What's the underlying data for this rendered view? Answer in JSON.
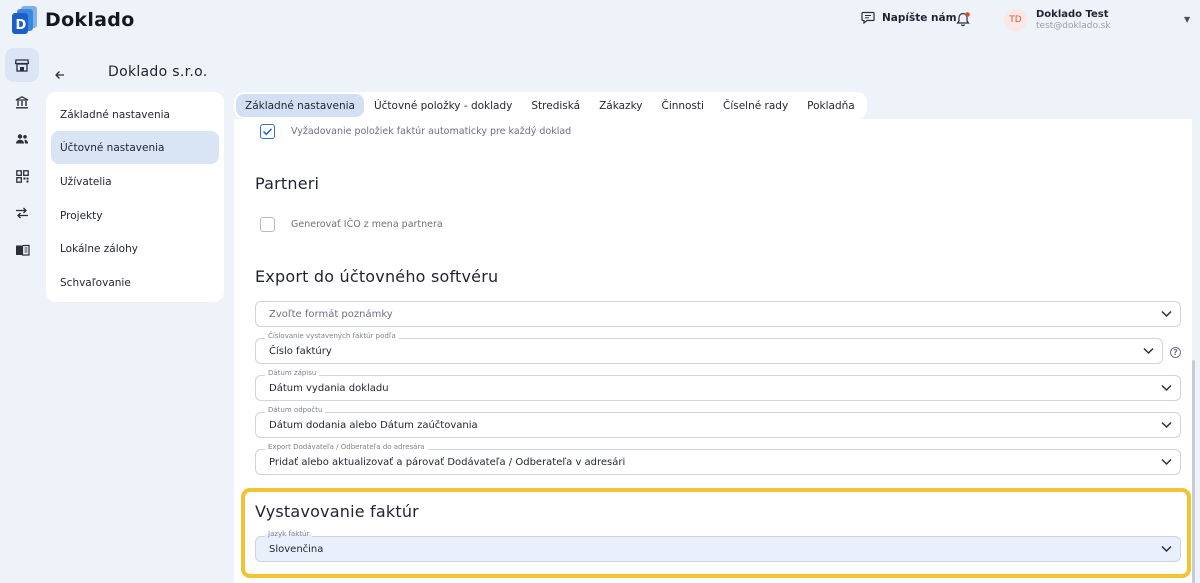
{
  "app": {
    "name": "Doklado"
  },
  "header": {
    "contact_label": "Napíšte nám",
    "avatar_initials": "TD",
    "user_name": "Doklado Test",
    "user_email": "test@doklado.sk"
  },
  "rail": {
    "icons": [
      "store-icon",
      "bank-icon",
      "people-icon",
      "qr-code-icon",
      "transfer-icon",
      "book-icon"
    ],
    "active_index": 0
  },
  "page": {
    "company_name": "Doklado s.r.o."
  },
  "sidebar": {
    "items": [
      {
        "label": "Základné nastavenia"
      },
      {
        "label": "Účtovné nastavenia"
      },
      {
        "label": "Užívatelia"
      },
      {
        "label": "Projekty"
      },
      {
        "label": "Lokálne zálohy"
      },
      {
        "label": "Schvaľovanie"
      }
    ],
    "active_index": 1
  },
  "tabs": {
    "items": [
      {
        "label": "Základné nastavenia"
      },
      {
        "label": "Účtovné položky - doklady"
      },
      {
        "label": "Strediská"
      },
      {
        "label": "Zákazky"
      },
      {
        "label": "Činnosti"
      },
      {
        "label": "Číselné rady"
      },
      {
        "label": "Pokladňa"
      }
    ],
    "active_index": 0
  },
  "main": {
    "require_items_checkbox": {
      "label": "Vyžadovanie položiek faktúr automaticky pre každý doklad",
      "checked": true
    },
    "partners": {
      "title": "Partneri",
      "generate_ico_checkbox": {
        "label": "Generovať IČO z mena partnera",
        "checked": false
      }
    },
    "export": {
      "title": "Export do účtovného softvéru",
      "note_format": {
        "placeholder": "Zvoľte formát poznámky"
      },
      "invoice_numbering": {
        "label": "Číslovanie vystavených faktúr podľa",
        "value": "Číslo faktúry",
        "help": "?"
      },
      "record_date": {
        "label": "Dátum zápisu",
        "value": "Dátum vydania dokladu"
      },
      "deduction_date": {
        "label": "Dátum odpočtu",
        "value": "Dátum dodania alebo Dátum zaúčtovania"
      },
      "address_book_export": {
        "label": "Export Dodávateľa / Odberateľa do adresára",
        "value": "Pridať alebo aktualizovať a párovať Dodávateľa / Odberateľa v adresári"
      }
    },
    "invoicing": {
      "title": "Vystavovanie faktúr",
      "language": {
        "label": "Jazyk faktúr",
        "value": "Slovenčina"
      }
    }
  },
  "colors": {
    "highlight": "#f3c431",
    "accent": "#2f6fd0",
    "active_bg": "#d9e4f5"
  }
}
